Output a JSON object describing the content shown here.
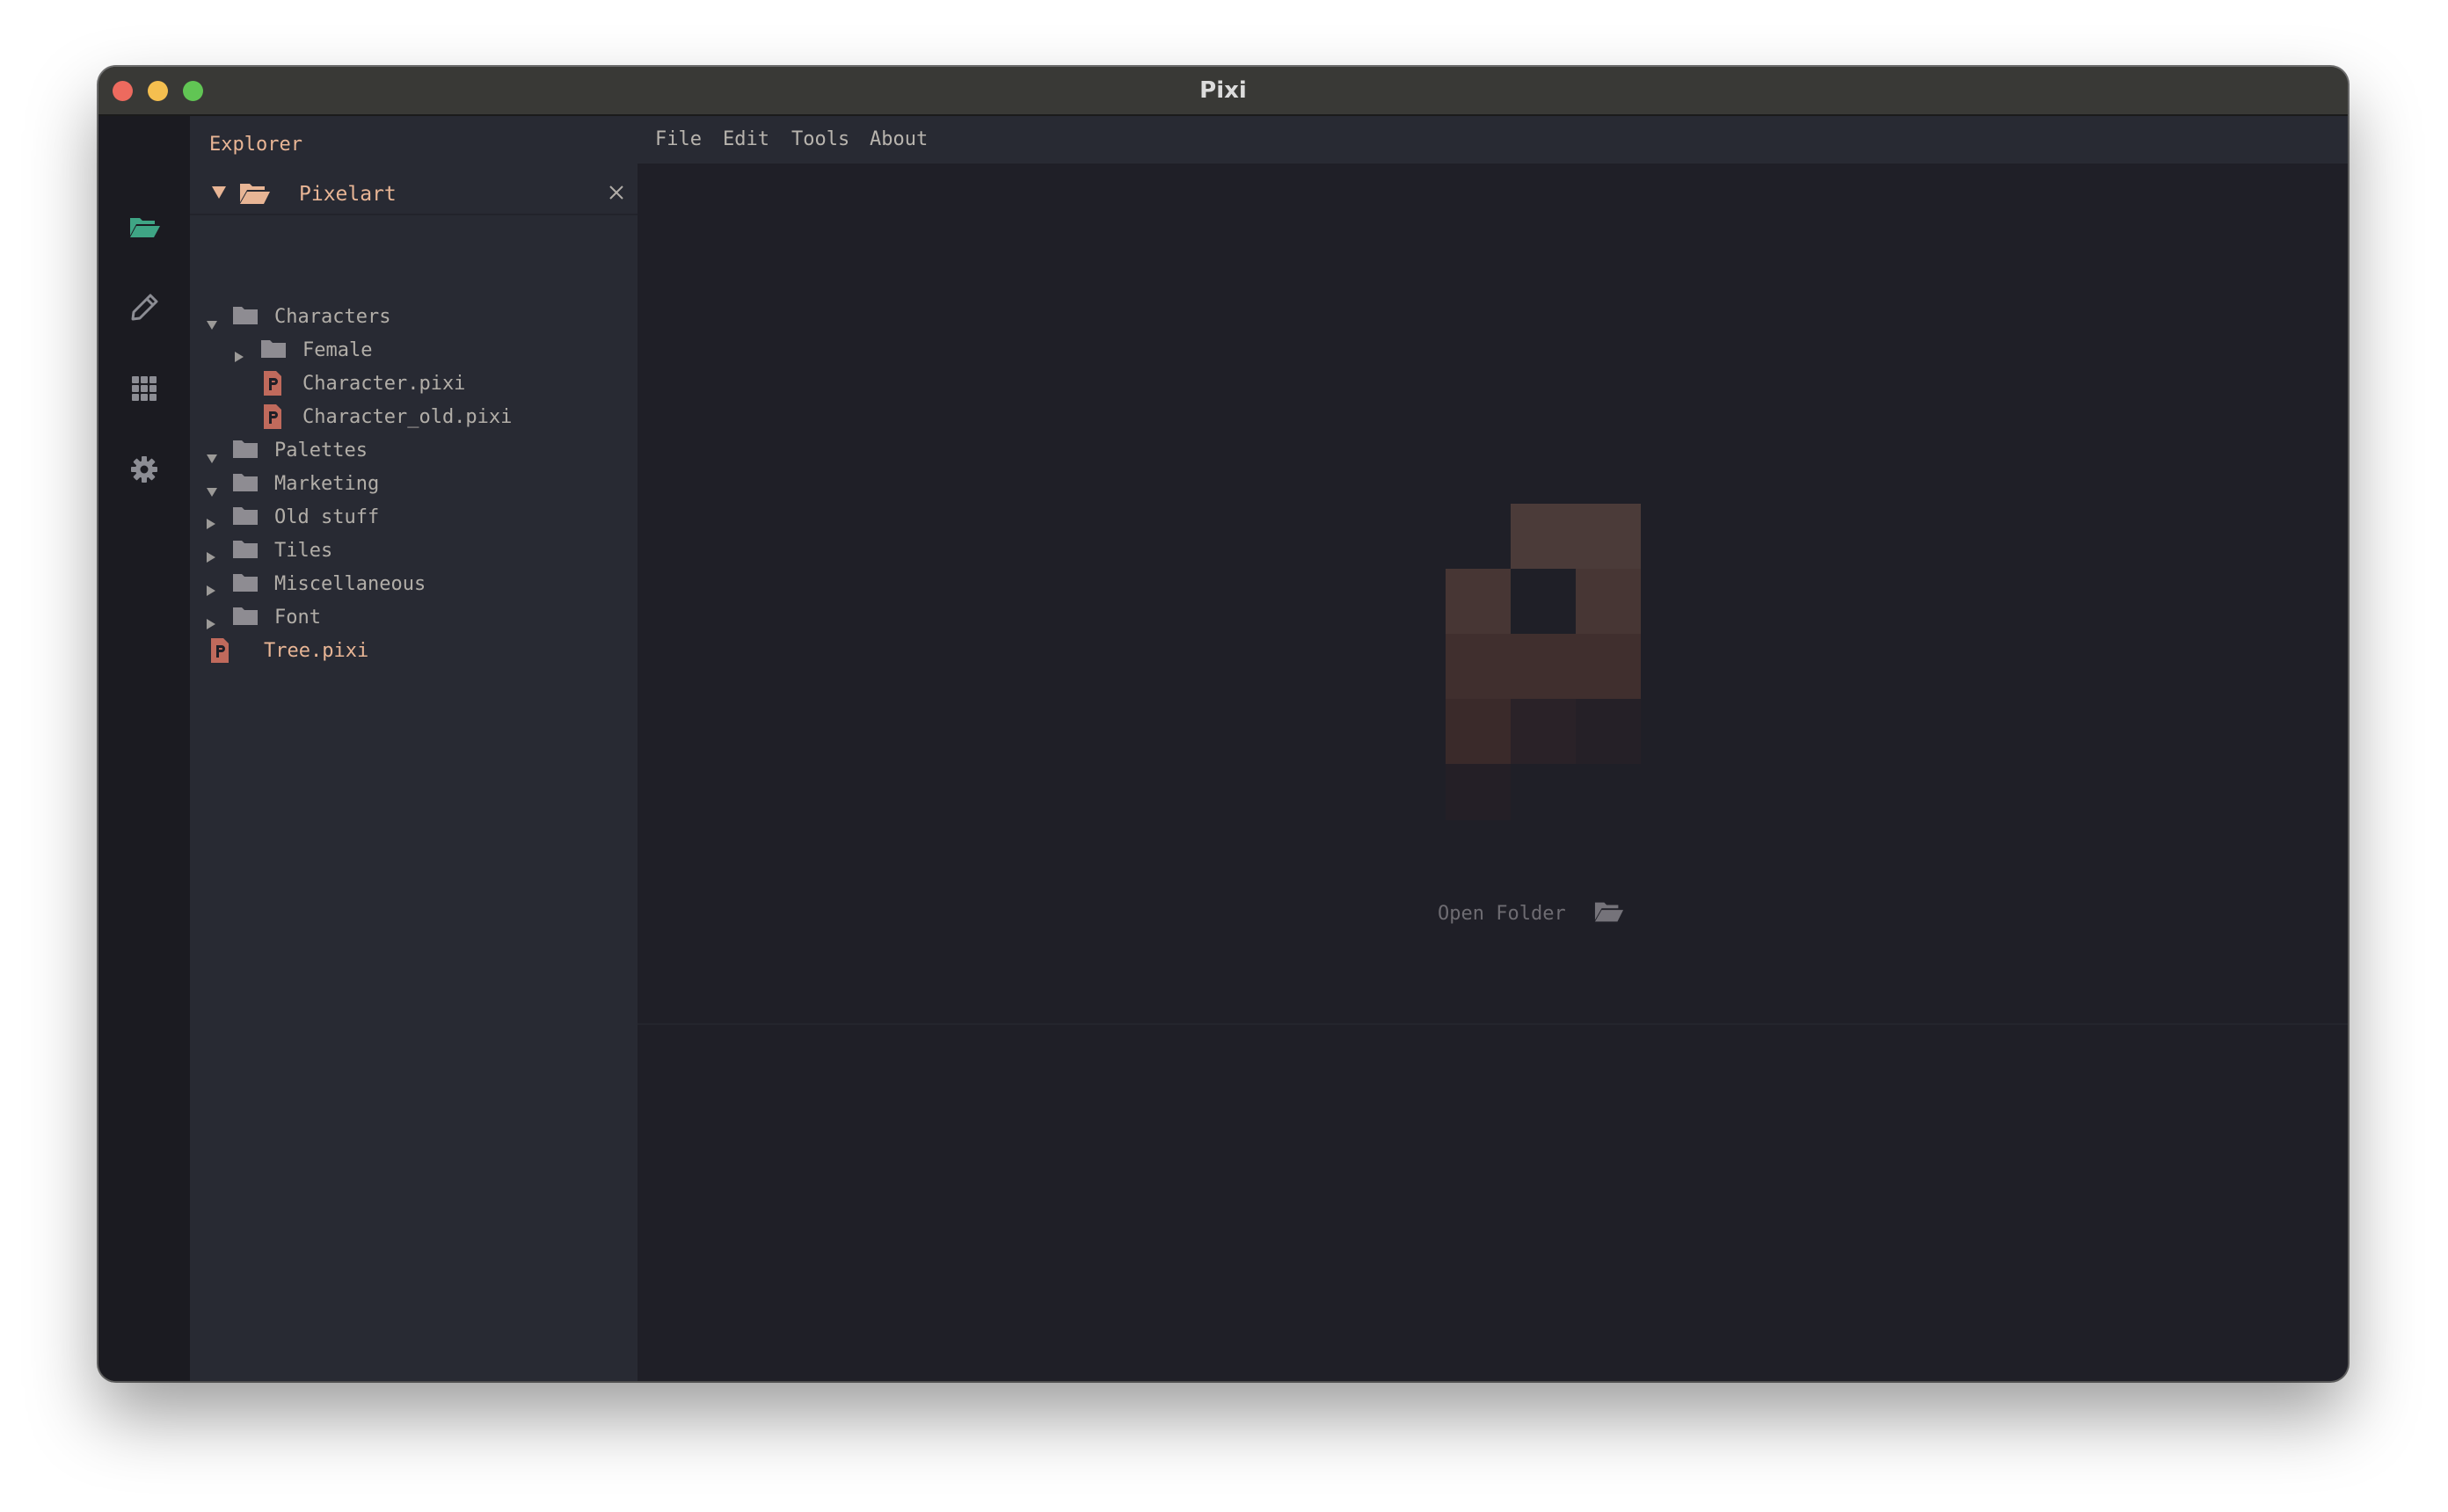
{
  "window": {
    "title": "Pixi"
  },
  "explorer": {
    "title": "Explorer",
    "root": "Pixelart",
    "items": [
      {
        "label": "Characters",
        "type": "folder",
        "expanded": true
      },
      {
        "label": "Female",
        "type": "folder",
        "expanded": false
      },
      {
        "label": "Character.pixi",
        "type": "file"
      },
      {
        "label": "Character_old.pixi",
        "type": "file"
      },
      {
        "label": "Palettes",
        "type": "folder",
        "expanded": true
      },
      {
        "label": "Marketing",
        "type": "folder",
        "expanded": true
      },
      {
        "label": "Old stuff",
        "type": "folder",
        "expanded": false
      },
      {
        "label": "Tiles",
        "type": "folder",
        "expanded": false
      },
      {
        "label": "Miscellaneous",
        "type": "folder",
        "expanded": false
      },
      {
        "label": "Font",
        "type": "folder",
        "expanded": false
      },
      {
        "label": "Tree.pixi",
        "type": "file"
      }
    ]
  },
  "menu": {
    "file": "File",
    "edit": "Edit",
    "tools": "Tools",
    "about": "About"
  },
  "main": {
    "open_folder_label": "Open Folder"
  },
  "icons": {
    "activity": [
      "folder-open-icon",
      "pencil-icon",
      "grid-icon",
      "gear-icon"
    ],
    "file": "pixi-file-icon",
    "folder": "folder-icon"
  },
  "colors": {
    "accent_green": "#3fa585",
    "accent_peach": "#e8b595",
    "file_icon": "#c06a5c",
    "logo": "#4d3a37"
  }
}
